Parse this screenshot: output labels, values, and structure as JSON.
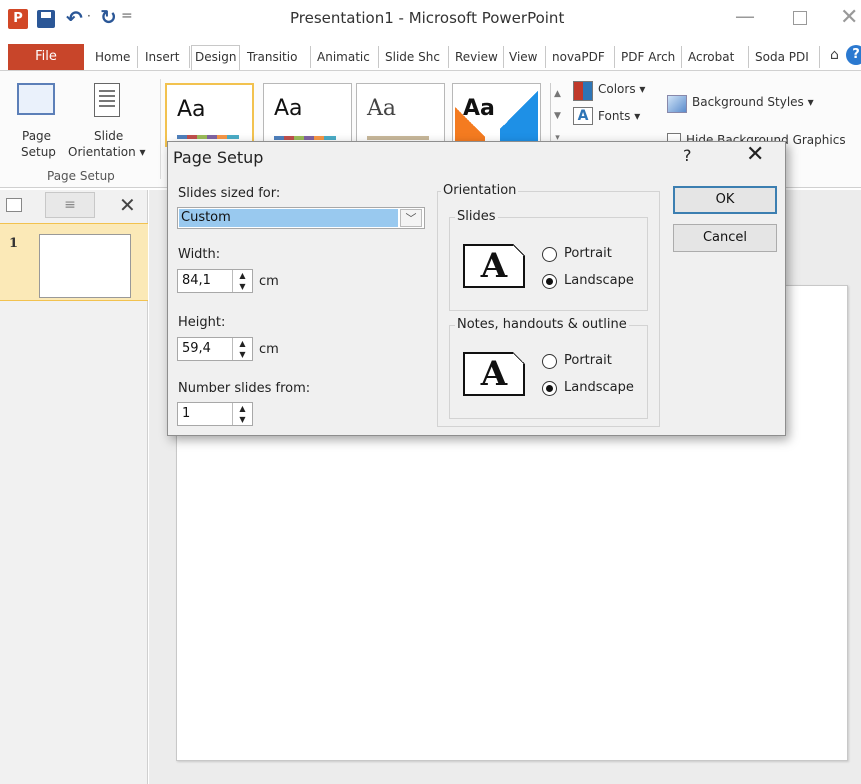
{
  "titlebar": {
    "app_icon": "P",
    "title": "Presentation1  -  Microsoft PowerPoint",
    "minimize": "—",
    "close": "✕",
    "qat_separator": "="
  },
  "tabs": {
    "file": "File",
    "items": [
      "Home",
      "Insert",
      "Design",
      "Transitio",
      "Animatic",
      "Slide Shc",
      "Review",
      "View",
      "novaPDF",
      "PDF Arch",
      "Acrobat",
      "Soda PDI"
    ],
    "active": "Design"
  },
  "ribbon": {
    "page_setup_label_1": "Page",
    "page_setup_label_2": "Setup",
    "orientation_label_1": "Slide",
    "orientation_label_2": "Orientation ▾",
    "group_page_setup": "Page Setup",
    "themes": [
      "Aa",
      "Aa",
      "Aa",
      "Aa"
    ],
    "colors": "Colors ▾",
    "fonts": "Fonts ▾",
    "background_styles": "Background Styles ▾",
    "hide_background_graphics": "Hide Background Graphics"
  },
  "slide_panel": {
    "slide_number": "1",
    "close": "✕",
    "outline_icon": "≡"
  },
  "dialog": {
    "title": "Page Setup",
    "help": "?",
    "close": "✕",
    "slides_sized_for_label": "Slides sized for:",
    "slides_sized_for_value": "Custom",
    "chevron": "﹀",
    "width_label": "Width:",
    "width_value": "84,1",
    "height_label": "Height:",
    "height_value": "59,4",
    "unit": "cm",
    "number_from_label": "Number slides from:",
    "number_from_value": "1",
    "orientation_group": "Orientation",
    "slides_group": "Slides",
    "notes_group": "Notes, handouts & outline",
    "icon_letter": "A",
    "portrait": "Portrait",
    "landscape": "Landscape",
    "slides_orientation": "landscape",
    "notes_orientation": "landscape",
    "ok": "OK",
    "cancel": "Cancel",
    "spin_up": "▲",
    "spin_down": "▼"
  },
  "colors": {
    "file_tab": "#c8452a",
    "selection": "#99c9ef",
    "thumb_highlight": "#fbe9b7"
  }
}
